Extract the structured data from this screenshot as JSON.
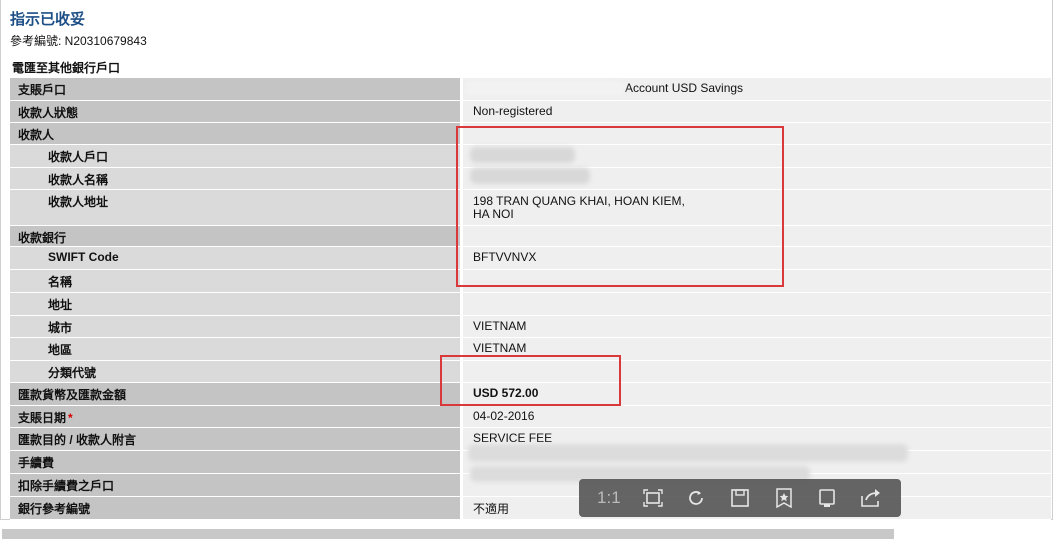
{
  "title": "指示已收妥",
  "reference": "參考編號: N20310679843",
  "section_title": "電匯至其他銀行戶口",
  "rows": [
    {
      "label": "支賬戶口",
      "value": "Account USD Savings"
    },
    {
      "label": "收款人狀態",
      "value": "Non-registered"
    },
    {
      "label": "收款人",
      "value": ""
    },
    {
      "label": "收款人戶口",
      "value": ""
    },
    {
      "label": "收款人名稱",
      "value": ""
    },
    {
      "label": "收款人地址",
      "value": "198 TRAN QUANG KHAI, HOAN KIEM,\nHA NOI"
    },
    {
      "label": "收款銀行",
      "value": ""
    },
    {
      "label": "SWIFT Code",
      "value": "BFTVVNVX"
    },
    {
      "label": "名稱",
      "value": ""
    },
    {
      "label": "地址",
      "value": ""
    },
    {
      "label": "城市",
      "value": "VIETNAM"
    },
    {
      "label": "地區",
      "value": "VIETNAM"
    },
    {
      "label": "分類代號",
      "value": ""
    },
    {
      "label": "匯款貨幣及匯款金額",
      "value": "USD 572.00"
    },
    {
      "label": "支賬日期",
      "required_mark": "*",
      "value": "04-02-2016"
    },
    {
      "label": "匯款目的 / 收款人附言",
      "value": "SERVICE FEE"
    },
    {
      "label": "手續費",
      "value": ""
    },
    {
      "label": "扣除手續費之戶口",
      "value": ""
    },
    {
      "label": "銀行參考編號",
      "value": "不適用"
    }
  ],
  "toolbar": {
    "zoom_label": "1:1",
    "icons": [
      "fit-screen-icon",
      "rotate-icon",
      "save-icon",
      "bookmark-star-icon",
      "device-icon",
      "share-icon"
    ]
  },
  "colors": {
    "label_bg": "#c4c4c4",
    "sub_label_bg": "#dadada",
    "value_bg": "#efefef",
    "title_blue": "#1d4f86",
    "annotation_red": "#d9393a"
  }
}
